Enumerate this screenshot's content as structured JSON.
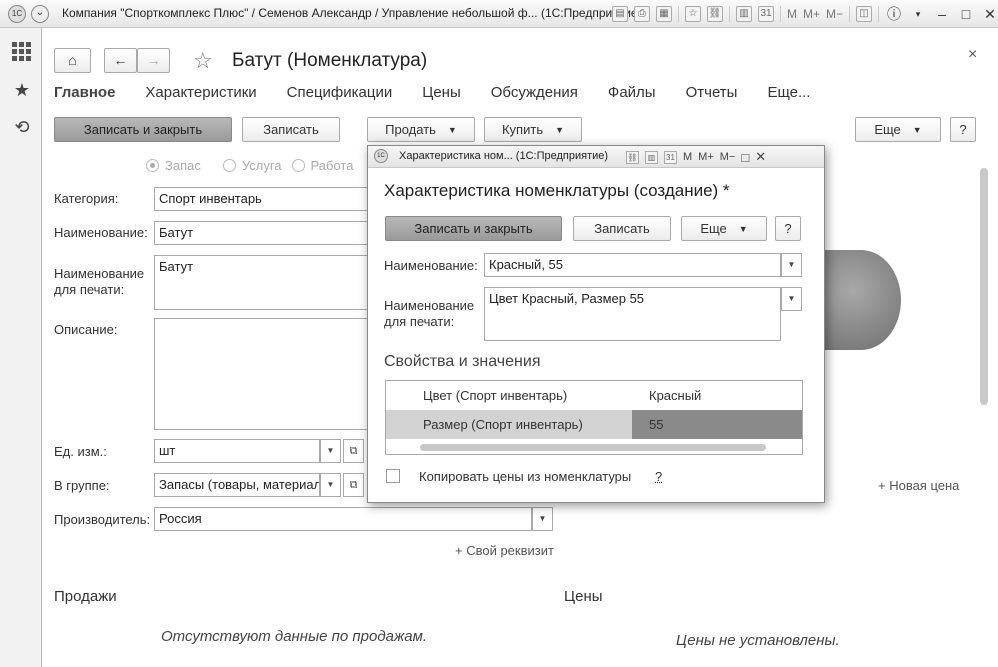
{
  "titlebar": {
    "title": "Компания \"Спорткомплекс Плюс\" / Семенов Александр / Управление небольшой ф...  (1С:Предприятие)",
    "icons": [
      "save-icon",
      "print-icon",
      "preview-icon",
      "favorites-icon",
      "link-icon",
      "calculator-icon",
      "calendar-icon"
    ],
    "memory_buttons": [
      "M",
      "M+",
      "M−"
    ],
    "controls": [
      "info-icon",
      "minimize",
      "maximize",
      "close"
    ]
  },
  "leftbar": {
    "items": [
      "apps-grid-icon",
      "favorites-star-icon",
      "history-icon"
    ]
  },
  "form": {
    "title": "Батут (Номенклатура)",
    "close": "×",
    "tabs": [
      "Главное",
      "Характеристики",
      "Спецификации",
      "Цены",
      "Обсуждения",
      "Файлы",
      "Отчеты",
      "Еще..."
    ],
    "toolbar": {
      "save_close": "Записать и закрыть",
      "save": "Записать",
      "sell": "Продать",
      "buy": "Купить",
      "more": "Еще",
      "help": "?"
    },
    "type_options": [
      "Запас",
      "Услуга",
      "Работа"
    ],
    "labels": {
      "category": "Категория:",
      "name": "Наименование:",
      "print_name": "Наименование\nдля печати:",
      "description": "Описание:",
      "unit": "Ед. изм.:",
      "group": "В группе:",
      "manufacturer": "Производитель:"
    },
    "values": {
      "category": "Спорт инвентарь",
      "name": "Батут",
      "print_name": "Батут",
      "description": "",
      "unit": "шт",
      "group": "Запасы (товары, материалы)",
      "manufacturer": "Россия"
    },
    "add_attribute": "+ Свой реквизит",
    "new_price": "+ Новая цена",
    "sales_header": "Продажи",
    "sales_empty": "Отсутствуют данные по продажам.",
    "prices_header": "Цены",
    "prices_empty": "Цены не установлены."
  },
  "popup": {
    "window_title": "Характеристика ном...  (1С:Предприятие)",
    "title": "Характеристика номенклатуры (создание) *",
    "toolbar": {
      "save_close": "Записать и закрыть",
      "save": "Записать",
      "more": "Еще",
      "help": "?"
    },
    "labels": {
      "name": "Наименование:",
      "print_name": "Наименование\nдля печати:"
    },
    "values": {
      "name": "Красный, 55",
      "print_name": "Цвет Красный, Размер 55"
    },
    "props_header": "Свойства и значения",
    "props": [
      {
        "property": "Цвет (Спорт инвентарь)",
        "value": "Красный"
      },
      {
        "property": "Размер (Спорт инвентарь)",
        "value": "55"
      }
    ],
    "copy_prices_label": "Копировать цены из номенклатуры",
    "copy_prices_help": "?"
  }
}
